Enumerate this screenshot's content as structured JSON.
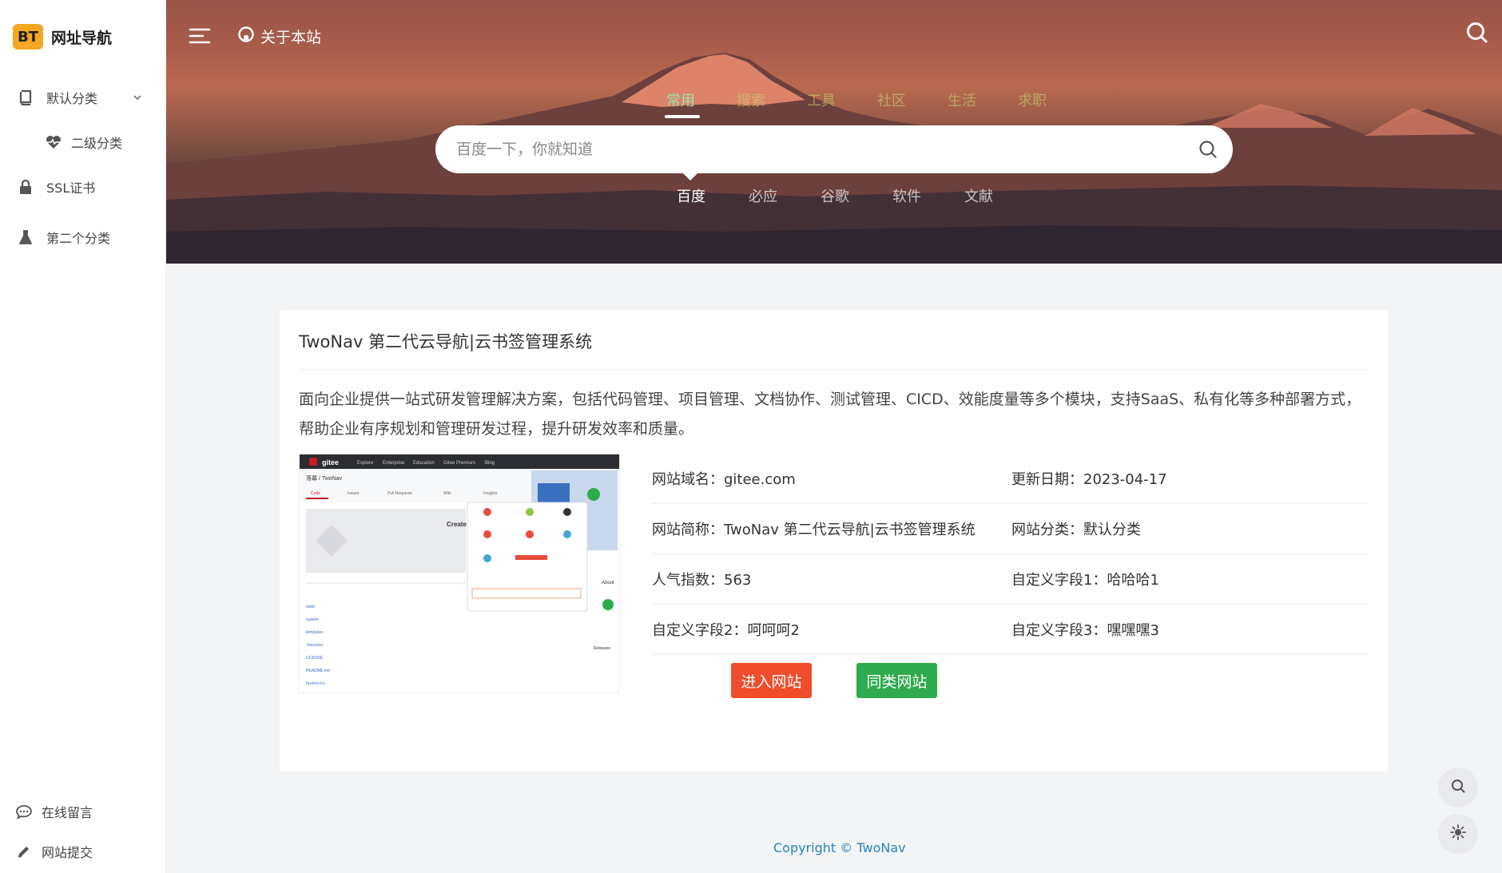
{
  "brand": {
    "badge": "BT",
    "name": "网址导航"
  },
  "sidebar": {
    "items": [
      {
        "label": "默认分类",
        "icon": "book-icon"
      },
      {
        "label": "二级分类",
        "icon": "heartbeat-icon"
      },
      {
        "label": "SSL证书",
        "icon": "lock-icon"
      },
      {
        "label": "第二个分类",
        "icon": "flask-icon"
      }
    ],
    "footer": [
      {
        "label": "在线留言",
        "icon": "comment-icon"
      },
      {
        "label": "网站提交",
        "icon": "pencil-icon"
      }
    ]
  },
  "header": {
    "about_label": "关于本站"
  },
  "search": {
    "categories": [
      "常用",
      "搜索",
      "工具",
      "社区",
      "生活",
      "求职"
    ],
    "active_category": "常用",
    "placeholder": "百度一下，你就知道",
    "engines": [
      "百度",
      "必应",
      "谷歌",
      "软件",
      "文献"
    ],
    "active_engine": "百度"
  },
  "site": {
    "title": "TwoNav 第二代云导航|云书签管理系统",
    "description": "面向企业提供一站式研发管理解决方案，包括代码管理、项目管理、文档协作、测试管理、CICD、效能度量等多个模块，支持SaaS、私有化等多种部署方式，帮助企业有序规划和管理研发过程，提升研发效率和质量。",
    "info": [
      [
        "网站域名：gitee.com",
        "更新日期：2023-04-17"
      ],
      [
        "网站简称：TwoNav 第二代云导航|云书签管理系统",
        "网站分类：默认分类"
      ],
      [
        "人气指数：563",
        "自定义字段1：哈哈哈1"
      ],
      [
        "自定义字段2：呵呵呵2",
        "自定义字段3：嘿嘿嘿3"
      ]
    ],
    "enter_label": "进入网站",
    "similar_label": "同类网站"
  },
  "preview": {
    "brand": "gitee",
    "nav": [
      "Explore",
      "Enterprise",
      "Education",
      "Gitee Premium",
      "Blog"
    ],
    "repo": "落幕 / TwoNav",
    "tabs": [
      "Code",
      "Issues",
      "Pull Requests",
      "Wiki",
      "Insights"
    ],
    "files": [
      "static",
      "system",
      "templates",
      ".htaccess",
      "LICENSE",
      "README.md",
      "favicon.ico"
    ],
    "create_label": "Create",
    "about_label": "About",
    "releases_label": "Releases"
  },
  "footer": {
    "copyright": "Copyright © TwoNav"
  },
  "colors": {
    "enter": "#ef4d2c",
    "similar": "#2eab4d",
    "logo": "#f5a623",
    "link": "#2c83b8"
  }
}
